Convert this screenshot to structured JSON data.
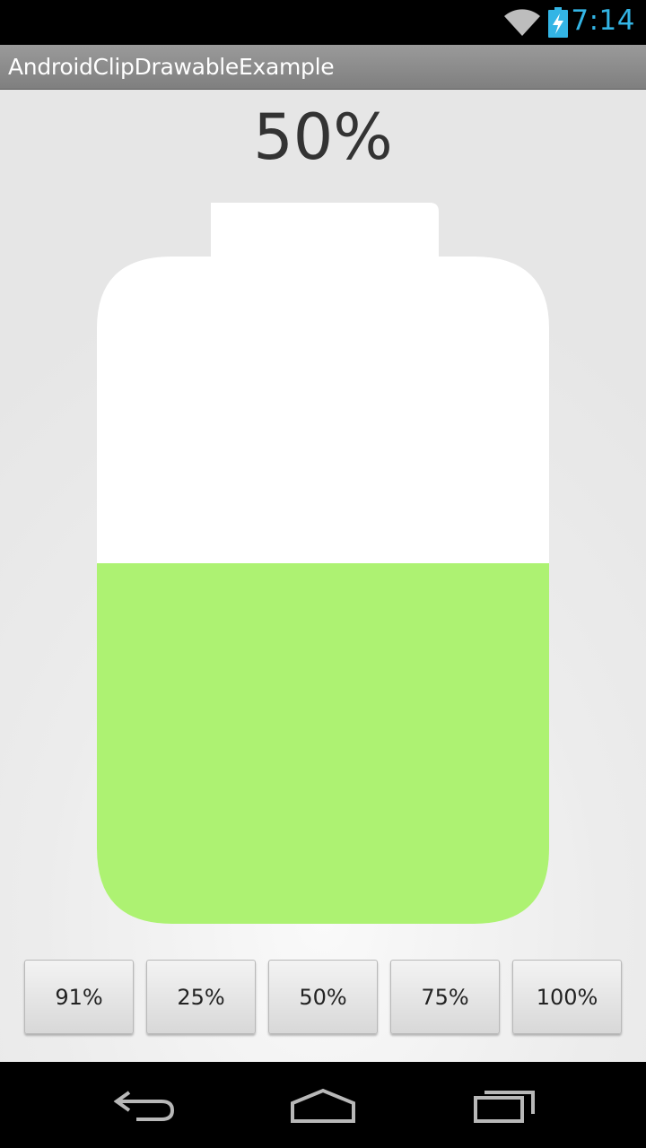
{
  "status_bar": {
    "time": "7:14",
    "icons": [
      "wifi-icon",
      "battery-charging-icon"
    ],
    "accent_color": "#33b5e5"
  },
  "action_bar": {
    "title": "AndroidClipDrawableExample"
  },
  "battery": {
    "label": "50%",
    "level": 0.5,
    "fill_color": "#adf272",
    "empty_color": "#ffffff"
  },
  "buttons": [
    {
      "label": "91%"
    },
    {
      "label": "25%"
    },
    {
      "label": "50%"
    },
    {
      "label": "75%"
    },
    {
      "label": "100%"
    }
  ],
  "nav_bar": {
    "icons": [
      "back-icon",
      "home-icon",
      "recent-apps-icon"
    ]
  }
}
